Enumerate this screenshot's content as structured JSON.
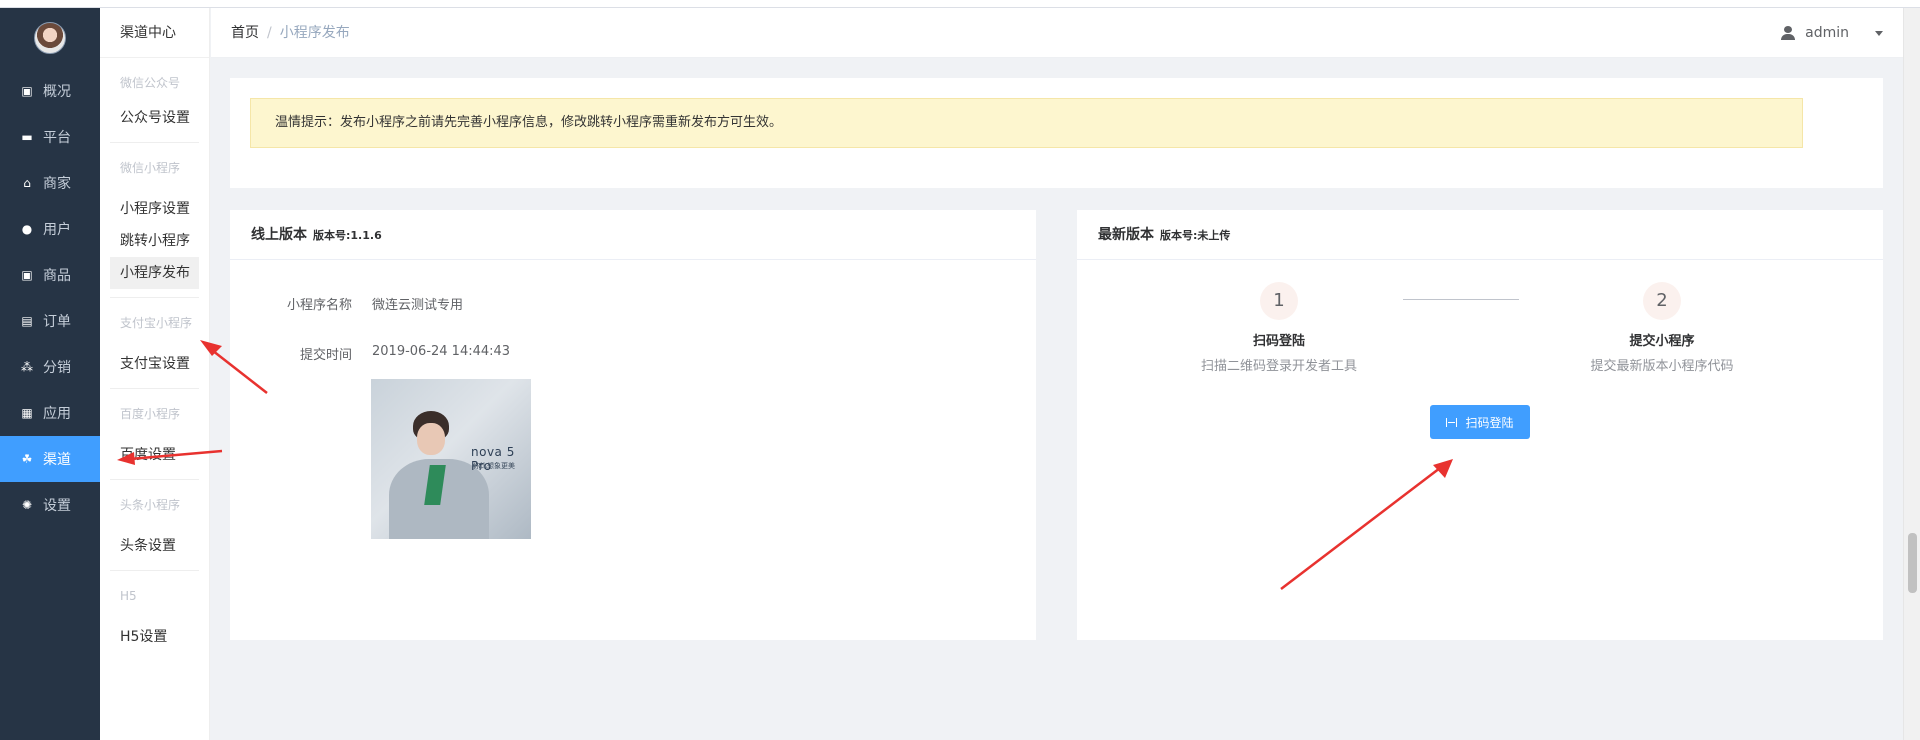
{
  "sidebar": {
    "items": [
      {
        "label": "概况",
        "icon": "monitor-chart-icon",
        "glyph": "▣"
      },
      {
        "label": "平台",
        "icon": "desktop-icon",
        "glyph": "▬"
      },
      {
        "label": "商家",
        "icon": "store-icon",
        "glyph": "⌂"
      },
      {
        "label": "用户",
        "icon": "user-circle-icon",
        "glyph": "●"
      },
      {
        "label": "商品",
        "icon": "product-box-icon",
        "glyph": "▣"
      },
      {
        "label": "订单",
        "icon": "order-clipboard-icon",
        "glyph": "▤"
      },
      {
        "label": "分销",
        "icon": "sitemap-icon",
        "glyph": "⁂"
      },
      {
        "label": "应用",
        "icon": "apps-grid-icon",
        "glyph": "▦"
      },
      {
        "label": "渠道",
        "icon": "channel-cluster-icon",
        "glyph": "☘",
        "active": true
      },
      {
        "label": "设置",
        "icon": "gear-icon",
        "glyph": "✺"
      }
    ]
  },
  "subbar": {
    "title": "渠道中心",
    "groups": [
      {
        "title": "微信公众号",
        "items": [
          "公众号设置"
        ]
      },
      {
        "title": "微信小程序",
        "items": [
          "小程序设置",
          "跳转小程序",
          "小程序发布"
        ]
      },
      {
        "title": "支付宝小程序",
        "items": [
          "支付宝设置"
        ]
      },
      {
        "title": "百度小程序",
        "items": [
          "百度设置"
        ]
      },
      {
        "title": "头条小程序",
        "items": [
          "头条设置"
        ]
      },
      {
        "title": "H5",
        "items": [
          "H5设置"
        ]
      }
    ],
    "active_item": "小程序发布"
  },
  "header": {
    "breadcrumb_home": "首页",
    "breadcrumb_sep": "/",
    "breadcrumb_current": "小程序发布",
    "username": "admin"
  },
  "notice": "温情提示：发布小程序之前请先完善小程序信息，修改跳转小程序需重新发布方可生效。",
  "online": {
    "title": "线上版本",
    "version": "版本号:1.1.6",
    "name_label": "小程序名称",
    "name_value": "微连云测试专用",
    "time_label": "提交时间",
    "time_value": "2019-06-24 14:44:43",
    "image_brand": "nova 5 Pro",
    "image_tagline": "你比想象更美"
  },
  "latest": {
    "title": "最新版本",
    "version": "版本号:未上传",
    "steps": [
      {
        "num": "1",
        "title": "扫码登陆",
        "desc": "扫描二维码登录开发者工具"
      },
      {
        "num": "2",
        "title": "提交小程序",
        "desc": "提交最新版本小程序代码"
      }
    ],
    "button": "扫码登陆"
  },
  "colors": {
    "sidebar_bg": "#263445",
    "accent": "#409eff",
    "notice_bg": "#fdf6cf",
    "annotation": "#e8322f"
  }
}
